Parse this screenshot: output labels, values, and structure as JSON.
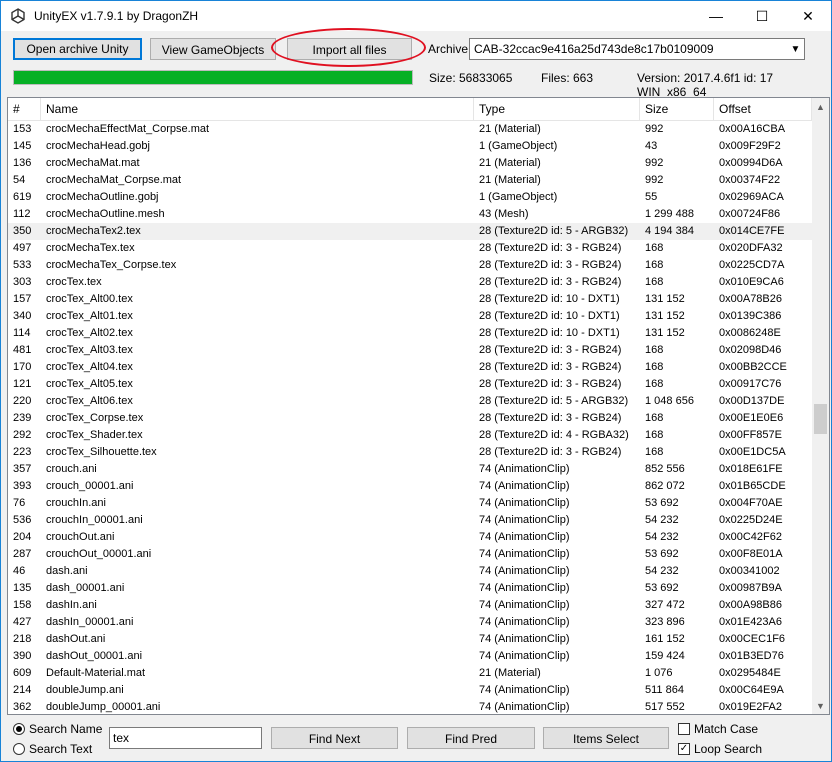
{
  "window": {
    "title": "UnityEX v1.7.9.1 by DragonZH"
  },
  "titlebar": {
    "minimize_icon": "minimize-icon",
    "maximize_icon": "maximize-icon",
    "close_icon": "close-icon",
    "min_glyph": "—",
    "max_glyph": "☐",
    "close_glyph": "✕"
  },
  "toolbar": {
    "open_archive": "Open archive Unity",
    "view_gameobjects": "View GameObjects",
    "import_all": "Import all files",
    "archive_label": "Archive",
    "archive_value": "CAB-32ccac9e416a25d743de8c17b0109009"
  },
  "status": {
    "progress": 1.0,
    "size": "Size: 56833065",
    "files": "Files: 663",
    "version": "Version: 2017.4.6f1 id: 17 WIN_x86_64"
  },
  "table": {
    "columns": [
      "#",
      "Name",
      "Type",
      "Size",
      "Offset"
    ],
    "rows": [
      [
        "153",
        "crocMechaEffectMat_Corpse.mat",
        "21 (Material)",
        "992",
        "0x00A16CBA"
      ],
      [
        "145",
        "crocMechaHead.gobj",
        "1 (GameObject)",
        "43",
        "0x009F29F2"
      ],
      [
        "136",
        "crocMechaMat.mat",
        "21 (Material)",
        "992",
        "0x00994D6A"
      ],
      [
        "54",
        "crocMechaMat_Corpse.mat",
        "21 (Material)",
        "992",
        "0x00374F22"
      ],
      [
        "619",
        "crocMechaOutline.gobj",
        "1 (GameObject)",
        "55",
        "0x02969ACA"
      ],
      [
        "112",
        "crocMechaOutline.mesh",
        "43 (Mesh)",
        "1 299 488",
        "0x00724F86"
      ],
      [
        "350",
        "crocMechaTex2.tex",
        "28 (Texture2D id: 5 - ARGB32)",
        "4 194 384",
        "0x014CE7FE"
      ],
      [
        "497",
        "crocMechaTex.tex",
        "28 (Texture2D id: 3 - RGB24)",
        "168",
        "0x020DFA32"
      ],
      [
        "533",
        "crocMechaTex_Corpse.tex",
        "28 (Texture2D id: 3 - RGB24)",
        "168",
        "0x0225CD7A"
      ],
      [
        "303",
        "crocTex.tex",
        "28 (Texture2D id: 3 - RGB24)",
        "168",
        "0x010E9CA6"
      ],
      [
        "157",
        "crocTex_Alt00.tex",
        "28 (Texture2D id: 10 - DXT1)",
        "131 152",
        "0x00A78B26"
      ],
      [
        "340",
        "crocTex_Alt01.tex",
        "28 (Texture2D id: 10 - DXT1)",
        "131 152",
        "0x0139C386"
      ],
      [
        "114",
        "crocTex_Alt02.tex",
        "28 (Texture2D id: 10 - DXT1)",
        "131 152",
        "0x0086248E"
      ],
      [
        "481",
        "crocTex_Alt03.tex",
        "28 (Texture2D id: 3 - RGB24)",
        "168",
        "0x02098D46"
      ],
      [
        "170",
        "crocTex_Alt04.tex",
        "28 (Texture2D id: 3 - RGB24)",
        "168",
        "0x00BB2CCE"
      ],
      [
        "121",
        "crocTex_Alt05.tex",
        "28 (Texture2D id: 3 - RGB24)",
        "168",
        "0x00917C76"
      ],
      [
        "220",
        "crocTex_Alt06.tex",
        "28 (Texture2D id: 5 - ARGB32)",
        "1 048 656",
        "0x00D137DE"
      ],
      [
        "239",
        "crocTex_Corpse.tex",
        "28 (Texture2D id: 3 - RGB24)",
        "168",
        "0x00E1E0E6"
      ],
      [
        "292",
        "crocTex_Shader.tex",
        "28 (Texture2D id: 4 - RGBA32)",
        "168",
        "0x00FF857E"
      ],
      [
        "223",
        "crocTex_Silhouette.tex",
        "28 (Texture2D id: 3 - RGB24)",
        "168",
        "0x00E1DC5A"
      ],
      [
        "357",
        "crouch.ani",
        "74 (AnimationClip)",
        "852 556",
        "0x018E61FE"
      ],
      [
        "393",
        "crouch_00001.ani",
        "74 (AnimationClip)",
        "862 072",
        "0x01B65CDE"
      ],
      [
        "76",
        "crouchIn.ani",
        "74 (AnimationClip)",
        "53 692",
        "0x004F70AE"
      ],
      [
        "536",
        "crouchIn_00001.ani",
        "74 (AnimationClip)",
        "54 232",
        "0x0225D24E"
      ],
      [
        "204",
        "crouchOut.ani",
        "74 (AnimationClip)",
        "54 232",
        "0x00C42F62"
      ],
      [
        "287",
        "crouchOut_00001.ani",
        "74 (AnimationClip)",
        "53 692",
        "0x00F8E01A"
      ],
      [
        "46",
        "dash.ani",
        "74 (AnimationClip)",
        "54 232",
        "0x00341002"
      ],
      [
        "135",
        "dash_00001.ani",
        "74 (AnimationClip)",
        "53 692",
        "0x00987B9A"
      ],
      [
        "158",
        "dashIn.ani",
        "74 (AnimationClip)",
        "327 472",
        "0x00A98B86"
      ],
      [
        "427",
        "dashIn_00001.ani",
        "74 (AnimationClip)",
        "323 896",
        "0x01E423A6"
      ],
      [
        "218",
        "dashOut.ani",
        "74 (AnimationClip)",
        "161 152",
        "0x00CEC1F6"
      ],
      [
        "390",
        "dashOut_00001.ani",
        "74 (AnimationClip)",
        "159 424",
        "0x01B3ED76"
      ],
      [
        "609",
        "Default-Material.mat",
        "21 (Material)",
        "1 076",
        "0x0295484E"
      ],
      [
        "214",
        "doubleJump.ani",
        "74 (AnimationClip)",
        "511 864",
        "0x00C64E9A"
      ],
      [
        "362",
        "doubleJump_00001.ani",
        "74 (AnimationClip)",
        "517 552",
        "0x019E2FA2"
      ]
    ],
    "selected_row": 6
  },
  "search": {
    "search_name": "Search Name",
    "search_text": "Search Text",
    "query": "tex",
    "find_next": "Find Next",
    "find_pred": "Find Pred",
    "items_select": "Items Select",
    "match_case": "Match Case",
    "loop_search": "Loop Search",
    "loop_checked": "✓"
  }
}
